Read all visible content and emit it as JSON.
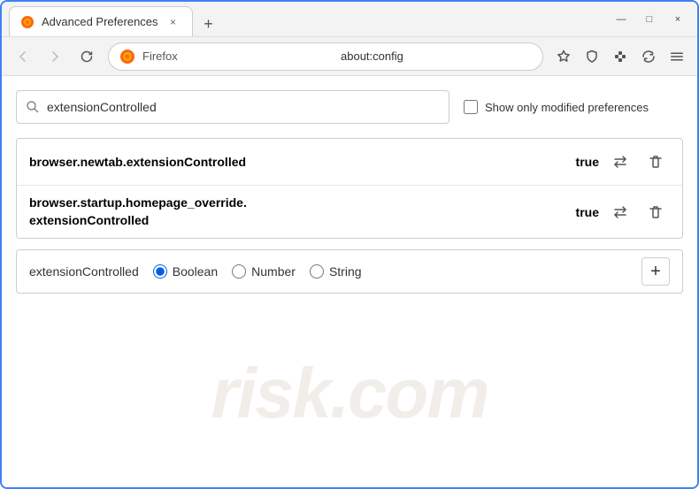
{
  "window": {
    "title": "Advanced Preferences",
    "tab_close": "×",
    "new_tab": "+",
    "controls": {
      "minimize": "—",
      "maximize": "□",
      "close": "×"
    }
  },
  "browser": {
    "name": "Firefox",
    "url": "about:config"
  },
  "search": {
    "value": "extensionControlled",
    "placeholder": "Search preference name",
    "checkbox_label": "Show only modified preferences"
  },
  "results": [
    {
      "name": "browser.newtab.extensionControlled",
      "value": "true"
    },
    {
      "name_line1": "browser.startup.homepage_override.",
      "name_line2": "extensionControlled",
      "value": "true"
    }
  ],
  "new_pref": {
    "name": "extensionControlled",
    "types": [
      {
        "value": "boolean",
        "label": "Boolean",
        "checked": true
      },
      {
        "value": "number",
        "label": "Number",
        "checked": false
      },
      {
        "value": "string",
        "label": "String",
        "checked": false
      }
    ],
    "add_label": "+"
  },
  "icons": {
    "search": "🔍",
    "swap": "⇌",
    "trash": "🗑",
    "back": "←",
    "forward": "→",
    "reload": "↻",
    "star": "☆",
    "shield": "🛡",
    "extension": "🧩",
    "sync": "⇌",
    "menu": "☰"
  },
  "watermark": "risk.com"
}
